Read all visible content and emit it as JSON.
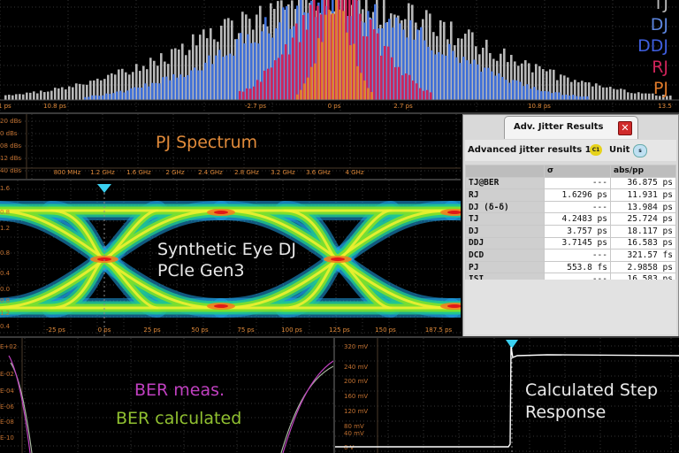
{
  "colors": {
    "tj": "#b8b8b8",
    "dj": "#3f6fd8",
    "ddj": "#2f4cc8",
    "rj": "#d0245a",
    "pj": "#e07a2a",
    "axis_orange": "#e08a3a",
    "ber_meas": "#c040c0",
    "ber_calc": "#90c030",
    "step": "#ffffff",
    "marker": "#3ad0f0"
  },
  "histogram": {
    "legend": [
      {
        "label": "TJ",
        "color": "#b8b8b8"
      },
      {
        "label": "DJ",
        "color": "#3f6fd8"
      },
      {
        "label": "DDJ",
        "color": "#2f4cc8"
      },
      {
        "label": "RJ",
        "color": "#d0245a"
      },
      {
        "label": "PJ",
        "color": "#e07a2a"
      }
    ],
    "x_ticks": [
      "-1 ps",
      "10.8 ps",
      "",
      "-2.7 ps",
      "",
      "0 ps",
      "",
      "2.7 ps",
      "",
      "10.8 ps",
      "13.5"
    ]
  },
  "pj_spectrum": {
    "title": "PJ Spectrum",
    "y_ticks": [
      "20 dBs",
      "0 dBs",
      "08 dBs",
      "12 dBs",
      "40 dBs"
    ],
    "x_ticks": [
      "800 MHz",
      "1.2 GHz",
      "1.6 GHz",
      "2 GHz",
      "2.4 GHz",
      "2.8 GHz",
      "3.2 GHz",
      "3.6 GHz",
      "4 GHz"
    ]
  },
  "eye": {
    "title_line1": "Synthetic Eye DJ",
    "title_line2": "PCIe Gen3",
    "x_ticks": [
      "-25 ps",
      "0 ps",
      "25 ps",
      "50 ps",
      "75 ps",
      "100 ps",
      "125 ps",
      "150 ps",
      "187.5 ps"
    ],
    "y_ticks": [
      "1.6",
      "0.8",
      "1.2",
      "0.8",
      "0.4",
      "0.0",
      "0.8",
      "1.2",
      "0.4"
    ]
  },
  "jitter_dialog": {
    "title": "Adv. Jitter Results",
    "close_glyph": "✕",
    "caption": "Advanced jitter results 1",
    "channel_badge": "C1",
    "unit_label": "Unit",
    "unit_value": "s",
    "columns": [
      "",
      "σ",
      "abs/pp"
    ],
    "rows": [
      {
        "name": "TJ@BER",
        "sigma": "---",
        "abspp": "36.875 ps"
      },
      {
        "name": "RJ",
        "sigma": "1.6296 ps",
        "abspp": "11.931 ps"
      },
      {
        "name": "DJ (δ-δ)",
        "sigma": "---",
        "abspp": "13.984 ps"
      },
      {
        "name": "TJ",
        "sigma": "4.2483 ps",
        "abspp": "25.724 ps"
      },
      {
        "name": "DJ",
        "sigma": "3.757 ps",
        "abspp": "18.117 ps"
      },
      {
        "name": "DDJ",
        "sigma": "3.7145 ps",
        "abspp": "16.583 ps"
      },
      {
        "name": "DCD",
        "sigma": "---",
        "abspp": "321.57 fs"
      },
      {
        "name": "PJ",
        "sigma": "553.8 fs",
        "abspp": "2.9858 ps"
      },
      {
        "name": "ISI",
        "sigma": "---",
        "abspp": "16.583 ps"
      }
    ]
  },
  "ber": {
    "label_meas": "BER meas.",
    "label_calc": "BER calculated",
    "y_ticks": [
      "E+02",
      "E-02",
      "E-04",
      "E-06",
      "E-08",
      "E-10"
    ]
  },
  "step": {
    "title_line1": "Calculated Step",
    "title_line2": "Response",
    "y_ticks": [
      "320 mV",
      "240 mV",
      "200 mV",
      "160 mV",
      "120 mV",
      "80 mV",
      "40 mV",
      "0 V"
    ]
  }
}
